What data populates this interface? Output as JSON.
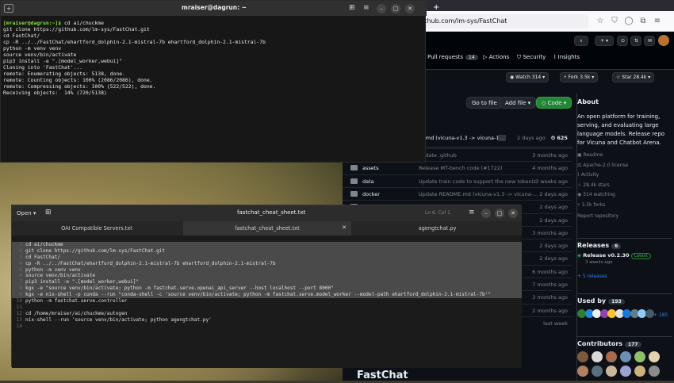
{
  "browser": {
    "tab_title": "mraiser@dagrun: ~",
    "url": "github.com/lm-sys/FastChat",
    "repo_fragment": "at",
    "nav": {
      "pull_requests_label": "Pull requests",
      "pull_requests_count": "14",
      "actions_label": "Actions",
      "security_label": "Security",
      "insights_label": "Insights"
    },
    "watch": {
      "label": "Watch",
      "count": "314"
    },
    "fork": {
      "label": "Fork",
      "count": "3.5k"
    },
    "star": {
      "label": "Star",
      "count": "28.4k"
    },
    "go_to_file": "Go to file",
    "add_file": "Add file",
    "code_btn": "Code",
    "commit": {
      "message": "DME.md (vicuna-v1.3 -> vicuna-1...",
      "ellipsis": "...",
      "time": "2 days ago",
      "count": "625"
    },
    "files": [
      {
        "name": "",
        "message": "update .github",
        "date": "3 months ago"
      },
      {
        "name": "assets",
        "message": "Release MT-bench code (#1722)",
        "date": "4 months ago"
      },
      {
        "name": "data",
        "message": "Update train code to support the new tokeniz...",
        "date": "3 weeks ago"
      },
      {
        "name": "docker",
        "message": "Update README.md (vicuna-v1.3 -> vicuna-...",
        "date": "2 days ago"
      },
      {
        "name": "",
        "message": "",
        "date": "2 days ago"
      },
      {
        "name": "",
        "message": "",
        "date": "2 days ago"
      },
      {
        "name": "",
        "message": "",
        "date": "3 months ago"
      },
      {
        "name": "",
        "message": "",
        "date": "2 days ago"
      },
      {
        "name": "",
        "message": "",
        "date": "2 days ago"
      },
      {
        "name": "",
        "message": "",
        "date": "6 months ago"
      },
      {
        "name": "",
        "message": "",
        "date": "7 months ago"
      },
      {
        "name": "",
        "message": "",
        "date": "3 months ago"
      },
      {
        "name": "",
        "message": "",
        "date": "2 months ago"
      },
      {
        "name": "",
        "message": "",
        "date": "last week"
      }
    ],
    "about": {
      "heading": "About",
      "description": "An open platform for training, serving, and evaluating large language models. Release repo for Vicuna and Chatbot Arena.",
      "items": [
        "Readme",
        "Apache-2.0 license",
        "Activity",
        "28.4k stars",
        "314 watching",
        "3.5k forks",
        "Report repository"
      ]
    },
    "releases": {
      "heading": "Releases",
      "count": "6",
      "latest_name": "Release v0.2.30",
      "latest_badge": "Latest",
      "latest_date": "3 weeks ago",
      "more": "+ 5 releases"
    },
    "used_by": {
      "heading": "Used by",
      "count": "193",
      "more": "+ 185"
    },
    "contributors": {
      "heading": "Contributors",
      "count": "177"
    },
    "readme_title": "FastChat"
  },
  "terminal": {
    "title": "mraiser@dagrun: ~",
    "prompt": "[mraiser@dagrun:~]$",
    "lines": [
      " cd ai/chuckme",
      "git clone https://github.com/lm-sys/FastChat.git",
      "cd FastChat/",
      "cp -R ../../FastChat/ehartford_dolphin-2.1-mistral-7b ehartford_dolphin-2.1-mistral-7b",
      "python -m venv venv",
      "source venv/bin/activate",
      "pip3 install -e \".[model_worker,webui]\"",
      "Cloning into 'FastChat'...",
      "remote: Enumerating objects: 5138, done.",
      "remote: Counting objects: 100% (2086/2086), done.",
      "remote: Compressing objects: 100% (522/522), done.",
      "Receiving objects:  14% (720/5138)"
    ]
  },
  "editor": {
    "open_label": "Open",
    "title": "fastchat_cheat_sheet.txt",
    "position": "Ln 6, Col 1",
    "tabs": [
      "OAI Compatible Servers.txt",
      "fastchat_cheat_sheet.txt",
      "agengtchat.py"
    ],
    "lines": [
      "cd ai/chuckme",
      "git clone https://github.com/lm-sys/FastChat.git",
      "cd FastChat/",
      "cp -R ../../FastChat/ehartford_dolphin-2.1-mistral-7b ehartford_dolphin-2.1-mistral-7b",
      "python -m venv venv",
      "source venv/bin/activate",
      "pip3 install -e \".[model_worker,webui]\"",
      "kgx -e \"source venv/bin/activate; python -m fastchat.serve.openai_api_server --host localhost --port 8000\"",
      "kgx -e nix-shell -p conda --run \"conda-shell -c 'source venv/bin/activate; python -m fastchat.serve.model_worker --model-path ehartford_dolphin-2.1-mistral-7b'\"",
      "python -m fastchat.serve.controller",
      "",
      "cd /home/mraiser/ai/chuckme/autogen",
      "nix-shell --run 'source venv/bin/activate; python agengtchat.py'",
      ""
    ]
  }
}
